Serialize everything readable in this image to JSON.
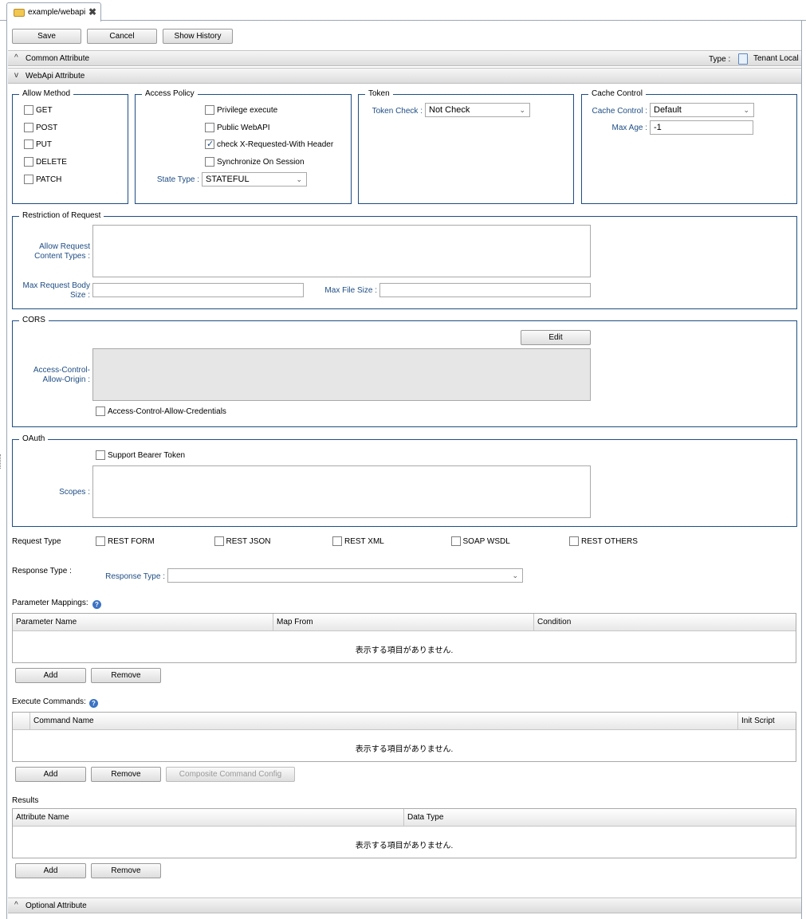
{
  "tab": {
    "title": "example/webapi",
    "close": "✖"
  },
  "toolbar": {
    "save": "Save",
    "cancel": "Cancel",
    "show_history": "Show History"
  },
  "common_section": {
    "title": "Common Attribute",
    "type_label": "Type :",
    "type_value": "Tenant Local",
    "chevron": "^"
  },
  "webapi_section": {
    "title": "WebApi Attribute",
    "chevron": "v"
  },
  "allow_method": {
    "legend": "Allow Method",
    "items": [
      {
        "label": "GET",
        "checked": false
      },
      {
        "label": "POST",
        "checked": false
      },
      {
        "label": "PUT",
        "checked": false
      },
      {
        "label": "DELETE",
        "checked": false
      },
      {
        "label": "PATCH",
        "checked": false
      }
    ]
  },
  "access_policy": {
    "legend": "Access Policy",
    "items": [
      {
        "label": "Privilege execute",
        "checked": false
      },
      {
        "label": "Public WebAPI",
        "checked": false
      },
      {
        "label": "check X-Requested-With Header",
        "checked": true
      },
      {
        "label": "Synchronize On Session",
        "checked": false
      }
    ],
    "state_type_label": "State Type :",
    "state_type_value": "STATEFUL"
  },
  "token": {
    "legend": "Token",
    "check_label": "Token Check :",
    "check_value": "Not Check"
  },
  "cache_control": {
    "legend": "Cache Control",
    "label": "Cache Control :",
    "value": "Default",
    "max_age_label": "Max Age :",
    "max_age_value": "-1"
  },
  "restriction": {
    "legend": "Restriction of Request",
    "content_types_label_1": "Allow Request",
    "content_types_label_2": "Content Types :",
    "max_body_label_1": "Max Request Body",
    "max_body_label_2": "Size :",
    "max_file_label": "Max File Size :"
  },
  "cors": {
    "legend": "CORS",
    "edit": "Edit",
    "origin_label_1": "Access-Control-",
    "origin_label_2": "Allow-Origin :",
    "credentials_label": "Access-Control-Allow-Credentials"
  },
  "oauth": {
    "legend": "OAuth",
    "bearer_label": "Support Bearer Token",
    "scopes_label": "Scopes :"
  },
  "request_type": {
    "label": "Request Type",
    "items": [
      "REST FORM",
      "REST JSON",
      "REST XML",
      "SOAP WSDL",
      "REST OTHERS"
    ]
  },
  "response_type": {
    "label": "Response Type :",
    "field_label": "Response Type :",
    "value": ""
  },
  "param_mappings": {
    "label": "Parameter Mappings:",
    "columns": [
      "Parameter Name",
      "Map From",
      "Condition"
    ],
    "empty": "表示する項目がありません.",
    "add": "Add",
    "remove": "Remove"
  },
  "execute_commands": {
    "label": "Execute Commands:",
    "columns": [
      "Command Name",
      "Init Script"
    ],
    "empty": "表示する項目がありません.",
    "add": "Add",
    "remove": "Remove",
    "composite": "Composite Command Config"
  },
  "results": {
    "label": "Results",
    "columns": [
      "Attribute Name",
      "Data Type"
    ],
    "empty": "表示する項目がありません.",
    "add": "Add",
    "remove": "Remove"
  },
  "optional_section": {
    "title": "Optional Attribute",
    "chevron": "^"
  },
  "help_icon_glyph": "?",
  "colors": {
    "accent": "#1e4d84",
    "border": "#9aa7b6"
  }
}
